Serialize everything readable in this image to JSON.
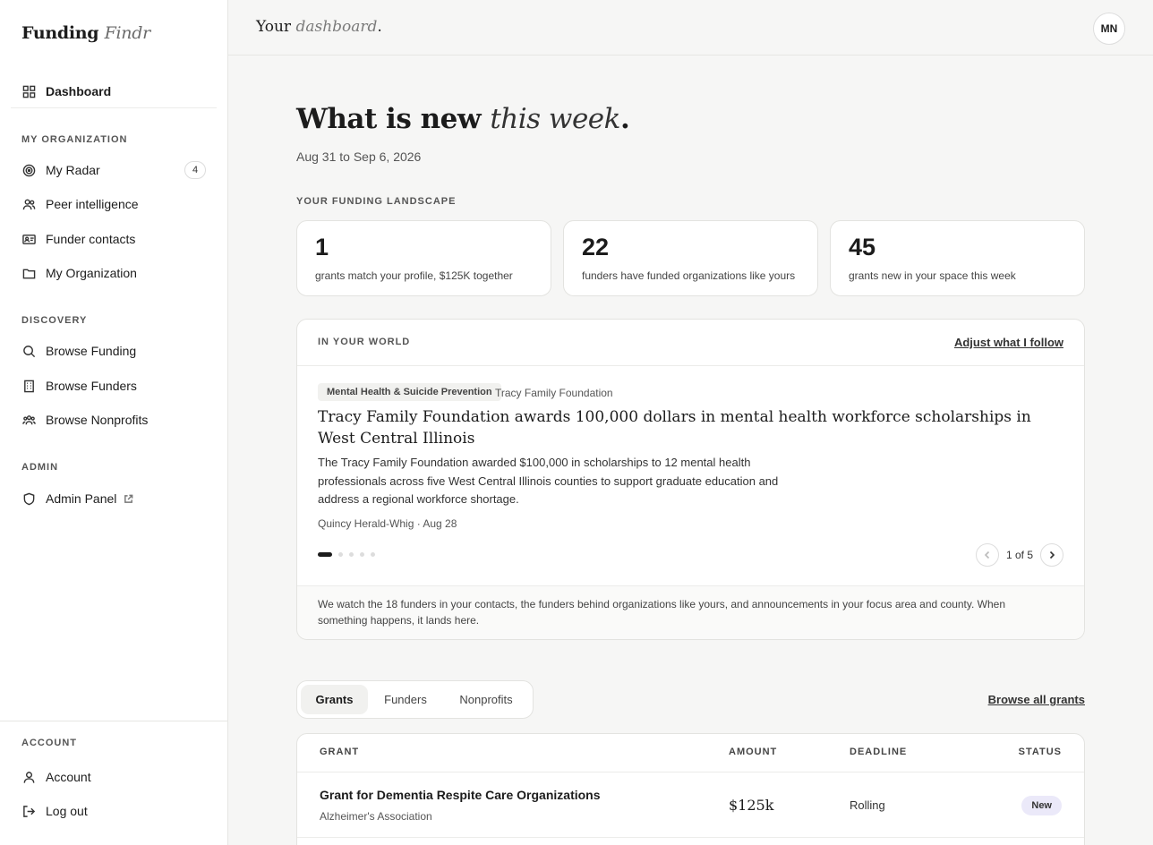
{
  "brand": {
    "main": "Funding",
    "accent": "Findr"
  },
  "sidebar": {
    "dashboard": "Dashboard",
    "sections": {
      "org": "MY ORGANIZATION",
      "discovery": "DISCOVERY",
      "admin": "ADMIN",
      "account": "ACCOUNT"
    },
    "org_items": [
      {
        "label": "My Radar",
        "badge": "4"
      },
      {
        "label": "Peer intelligence"
      },
      {
        "label": "Funder contacts"
      },
      {
        "label": "My Organization"
      }
    ],
    "discovery_items": [
      {
        "label": "Browse Funding"
      },
      {
        "label": "Browse Funders"
      },
      {
        "label": "Browse Nonprofits"
      }
    ],
    "admin_items": [
      {
        "label": "Admin Panel"
      }
    ],
    "account_items": [
      {
        "label": "Account"
      },
      {
        "label": "Log out"
      }
    ]
  },
  "topbar": {
    "title_a": "Your",
    "title_b": "dashboard",
    "title_c": ".",
    "avatar": "MN"
  },
  "main": {
    "headline_a": "What is new",
    "headline_b": "this week",
    "headline_c": ".",
    "daterange": "Aug 31 to Sep 6, 2026",
    "landscape_heading": "YOUR FUNDING LANDSCAPE",
    "stats": [
      {
        "num": "1",
        "label": "grants match your profile, $125K together"
      },
      {
        "num": "22",
        "label": "funders have funded organizations like yours"
      },
      {
        "num": "45",
        "label": "grants new in your space this week"
      }
    ],
    "world": {
      "heading": "IN YOUR WORLD",
      "adjust": "Adjust what I follow",
      "tag": "Mental Health & Suicide Prevention",
      "org": "Tracy Family Foundation",
      "title": "Tracy Family Foundation awards 100,000 dollars in mental health workforce scholarships in West Central Illinois",
      "body": "The Tracy Family Foundation awarded $100,000 in scholarships to 12 mental health professionals across five West Central Illinois counties to support graduate education and address a regional workforce shortage.",
      "source": "Quincy Herald-Whig · Aug 28",
      "pager": "1 of 5",
      "current_slide": 1,
      "total_slides": 5,
      "footer": "We watch the 18 funders in your contacts, the funders behind organizations like yours, and announcements in your focus area and county. When something happens, it lands here."
    },
    "tabs": [
      "Grants",
      "Funders",
      "Nonprofits"
    ],
    "browse_all": "Browse all grants",
    "table": {
      "headers": {
        "grant": "GRANT",
        "amount": "AMOUNT",
        "deadline": "DEADLINE",
        "status": "STATUS"
      },
      "rows": [
        {
          "name": "Grant for Dementia Respite Care Organizations",
          "funder": "Alzheimer's Association",
          "amount": "$125k",
          "deadline": "Rolling",
          "status": "New"
        }
      ]
    }
  },
  "colors": {
    "accent_status_bg": "#ebe9f9",
    "ink": "#1c1c1c",
    "page_bg": "#f6f6f5"
  }
}
